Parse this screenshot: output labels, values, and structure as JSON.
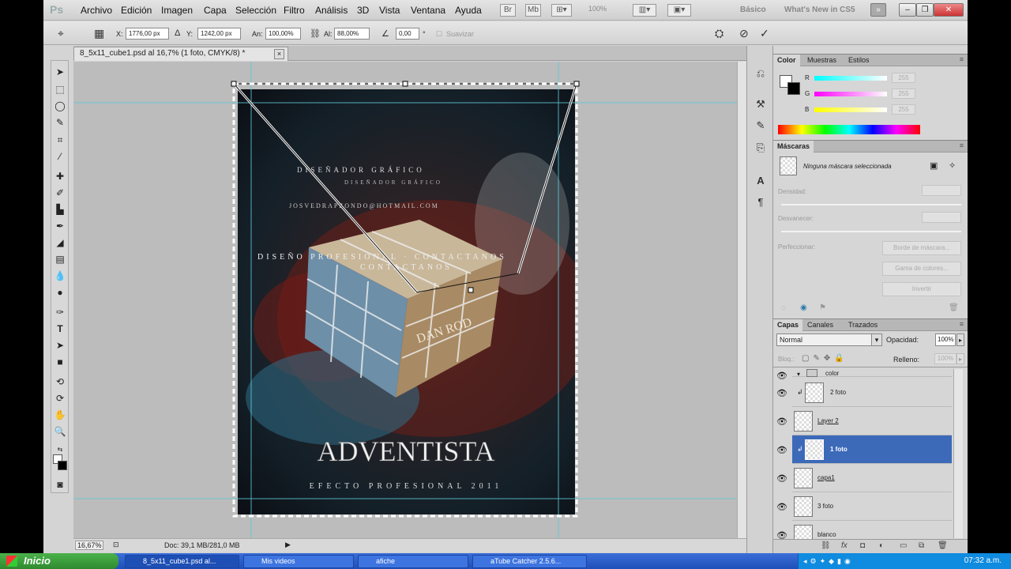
{
  "app": {
    "logo": "Ps"
  },
  "menu": [
    "Archivo",
    "Edición",
    "Imagen",
    "Capa",
    "Selección",
    "Filtro",
    "Análisis",
    "3D",
    "Vista",
    "Ventana",
    "Ayuda"
  ],
  "zoom_combo": "100%",
  "workspace": {
    "basic": "Básico",
    "whats_new": "What's New in CS5"
  },
  "options": {
    "x_label": "X:",
    "x_value": "1776,00 px",
    "y_label": "Y:",
    "y_value": "1242,00 px",
    "w_label": "An:",
    "w_value": "100,00%",
    "h_label": "Al:",
    "h_value": "88,00%",
    "angle_value": "0,00",
    "angle_unit": "°",
    "smooth_label": "Suavizar"
  },
  "document": {
    "tab_title": "8_5x11_cube1.psd al 16,7% (1 foto, CMYK/8) *",
    "close": "×"
  },
  "poster": {
    "line1": "DISEÑADOR GRÁFICO",
    "line2": "DISEÑADOR GRÁFICO",
    "contact": "DISEÑO PROFESIONAL · CONTACTANOS",
    "contact2": "CONTACTANOS",
    "email": "JOSVEDRAPZONDO@HOTMAIL.COM",
    "brand": "DAN ROD",
    "title": "ADVENTISTA",
    "subtitle": "EFECTO PROFESIONAL 2011"
  },
  "status": {
    "zoom": "16,67%",
    "doc": "Doc: 39,1 MB/281,0 MB"
  },
  "color_panel": {
    "tabs": [
      "Color",
      "Muestras",
      "Estilos"
    ],
    "channels": [
      {
        "label": "R",
        "value": "255"
      },
      {
        "label": "G",
        "value": "255"
      },
      {
        "label": "B",
        "value": "255"
      }
    ]
  },
  "masks_panel": {
    "tab": "Máscaras",
    "status": "Ninguna máscara seleccionada",
    "density": "Densidad:",
    "feather": "Desvanecer:",
    "refine": "Perfeccionar:",
    "btn_edge": "Borde de máscara...",
    "btn_range": "Gama de colores...",
    "btn_invert": "Invertir"
  },
  "layers_panel": {
    "tabs": [
      "Capas",
      "Canales",
      "Trazados"
    ],
    "blend": "Normal",
    "opacity_label": "Opacidad:",
    "opacity": "100%",
    "lock_label": "Bloq.:",
    "fill_label": "Relleno:",
    "fill": "100%",
    "layers": [
      {
        "name": "color",
        "selected": false
      },
      {
        "name": "2 foto",
        "selected": false
      },
      {
        "name": "Layer 2",
        "selected": false
      },
      {
        "name": "1 foto",
        "selected": true
      },
      {
        "name": "capa1",
        "selected": false
      },
      {
        "name": "3 foto",
        "selected": false
      },
      {
        "name": "blanco",
        "selected": false
      }
    ]
  },
  "taskbar": {
    "start": "Inicio",
    "tasks": [
      "8_5x11_cube1.psd al...",
      "Mis videos",
      "afiche",
      "aTube Catcher 2.5.6..."
    ],
    "clock": "07:32 a.m."
  }
}
